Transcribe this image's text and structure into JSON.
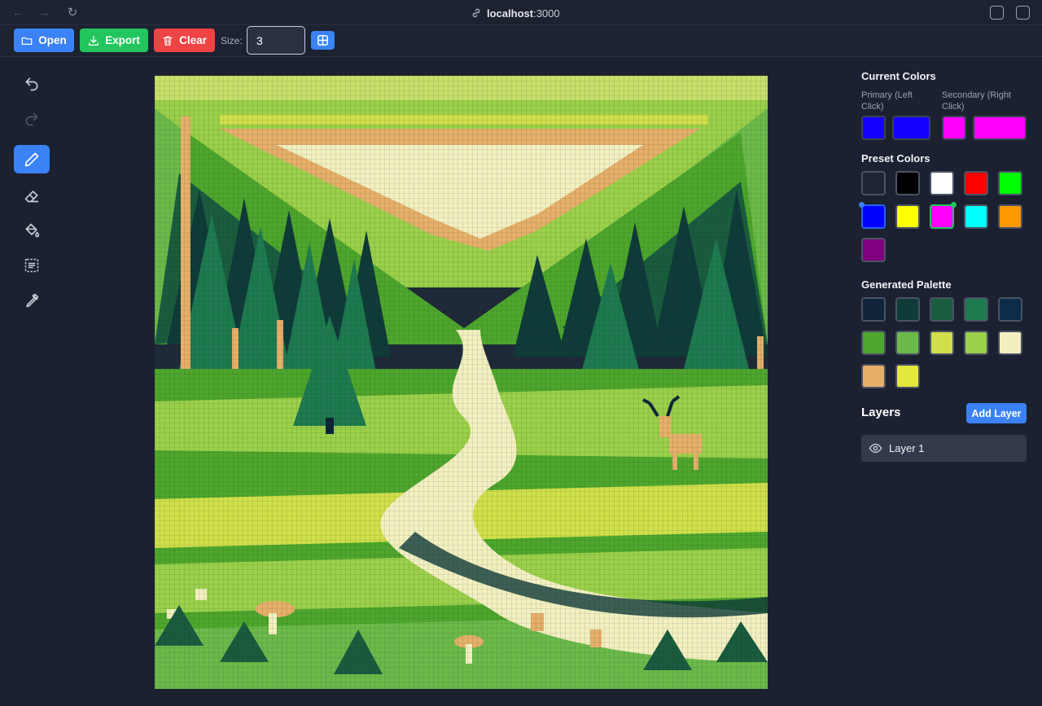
{
  "browser": {
    "url_host": "localhost",
    "url_port": ":3000"
  },
  "toolbar": {
    "open_label": "Open",
    "export_label": "Export",
    "clear_label": "Clear",
    "size_label": "Size:",
    "size_value": "3"
  },
  "tools": [
    "undo-icon",
    "redo-icon",
    "pencil-icon",
    "eraser-icon",
    "fill-bucket-icon",
    "select-icon",
    "eyedropper-icon"
  ],
  "active_tool": "pencil",
  "current_colors": {
    "title": "Current Colors",
    "primary_label": "Primary (Left Click)",
    "secondary_label": "Secondary (Right Click)",
    "primary": "#1400ff",
    "secondary": "#ff00ff"
  },
  "preset_colors": {
    "title": "Preset Colors",
    "colors": [
      "#1f2433",
      "#000000",
      "#ffffff",
      "#ff0000",
      "#00ff00",
      "#0000ff",
      "#ffff00",
      "#ff00ff",
      "#00ffff",
      "#ff9900",
      "#800080"
    ]
  },
  "generated_palette": {
    "title": "Generated Palette",
    "colors": [
      "#0f2439",
      "#0f3b38",
      "#1a5c3e",
      "#1e7a4f",
      "#0d2c4a",
      "#4ea62c",
      "#6cba4a",
      "#d0e04a",
      "#9bd04a",
      "#f3f0c0",
      "#e6b06a",
      "#e4e83a"
    ]
  },
  "layers": {
    "title": "Layers",
    "add_label": "Add Layer",
    "items": [
      {
        "name": "Layer 1",
        "visible": true
      }
    ]
  }
}
